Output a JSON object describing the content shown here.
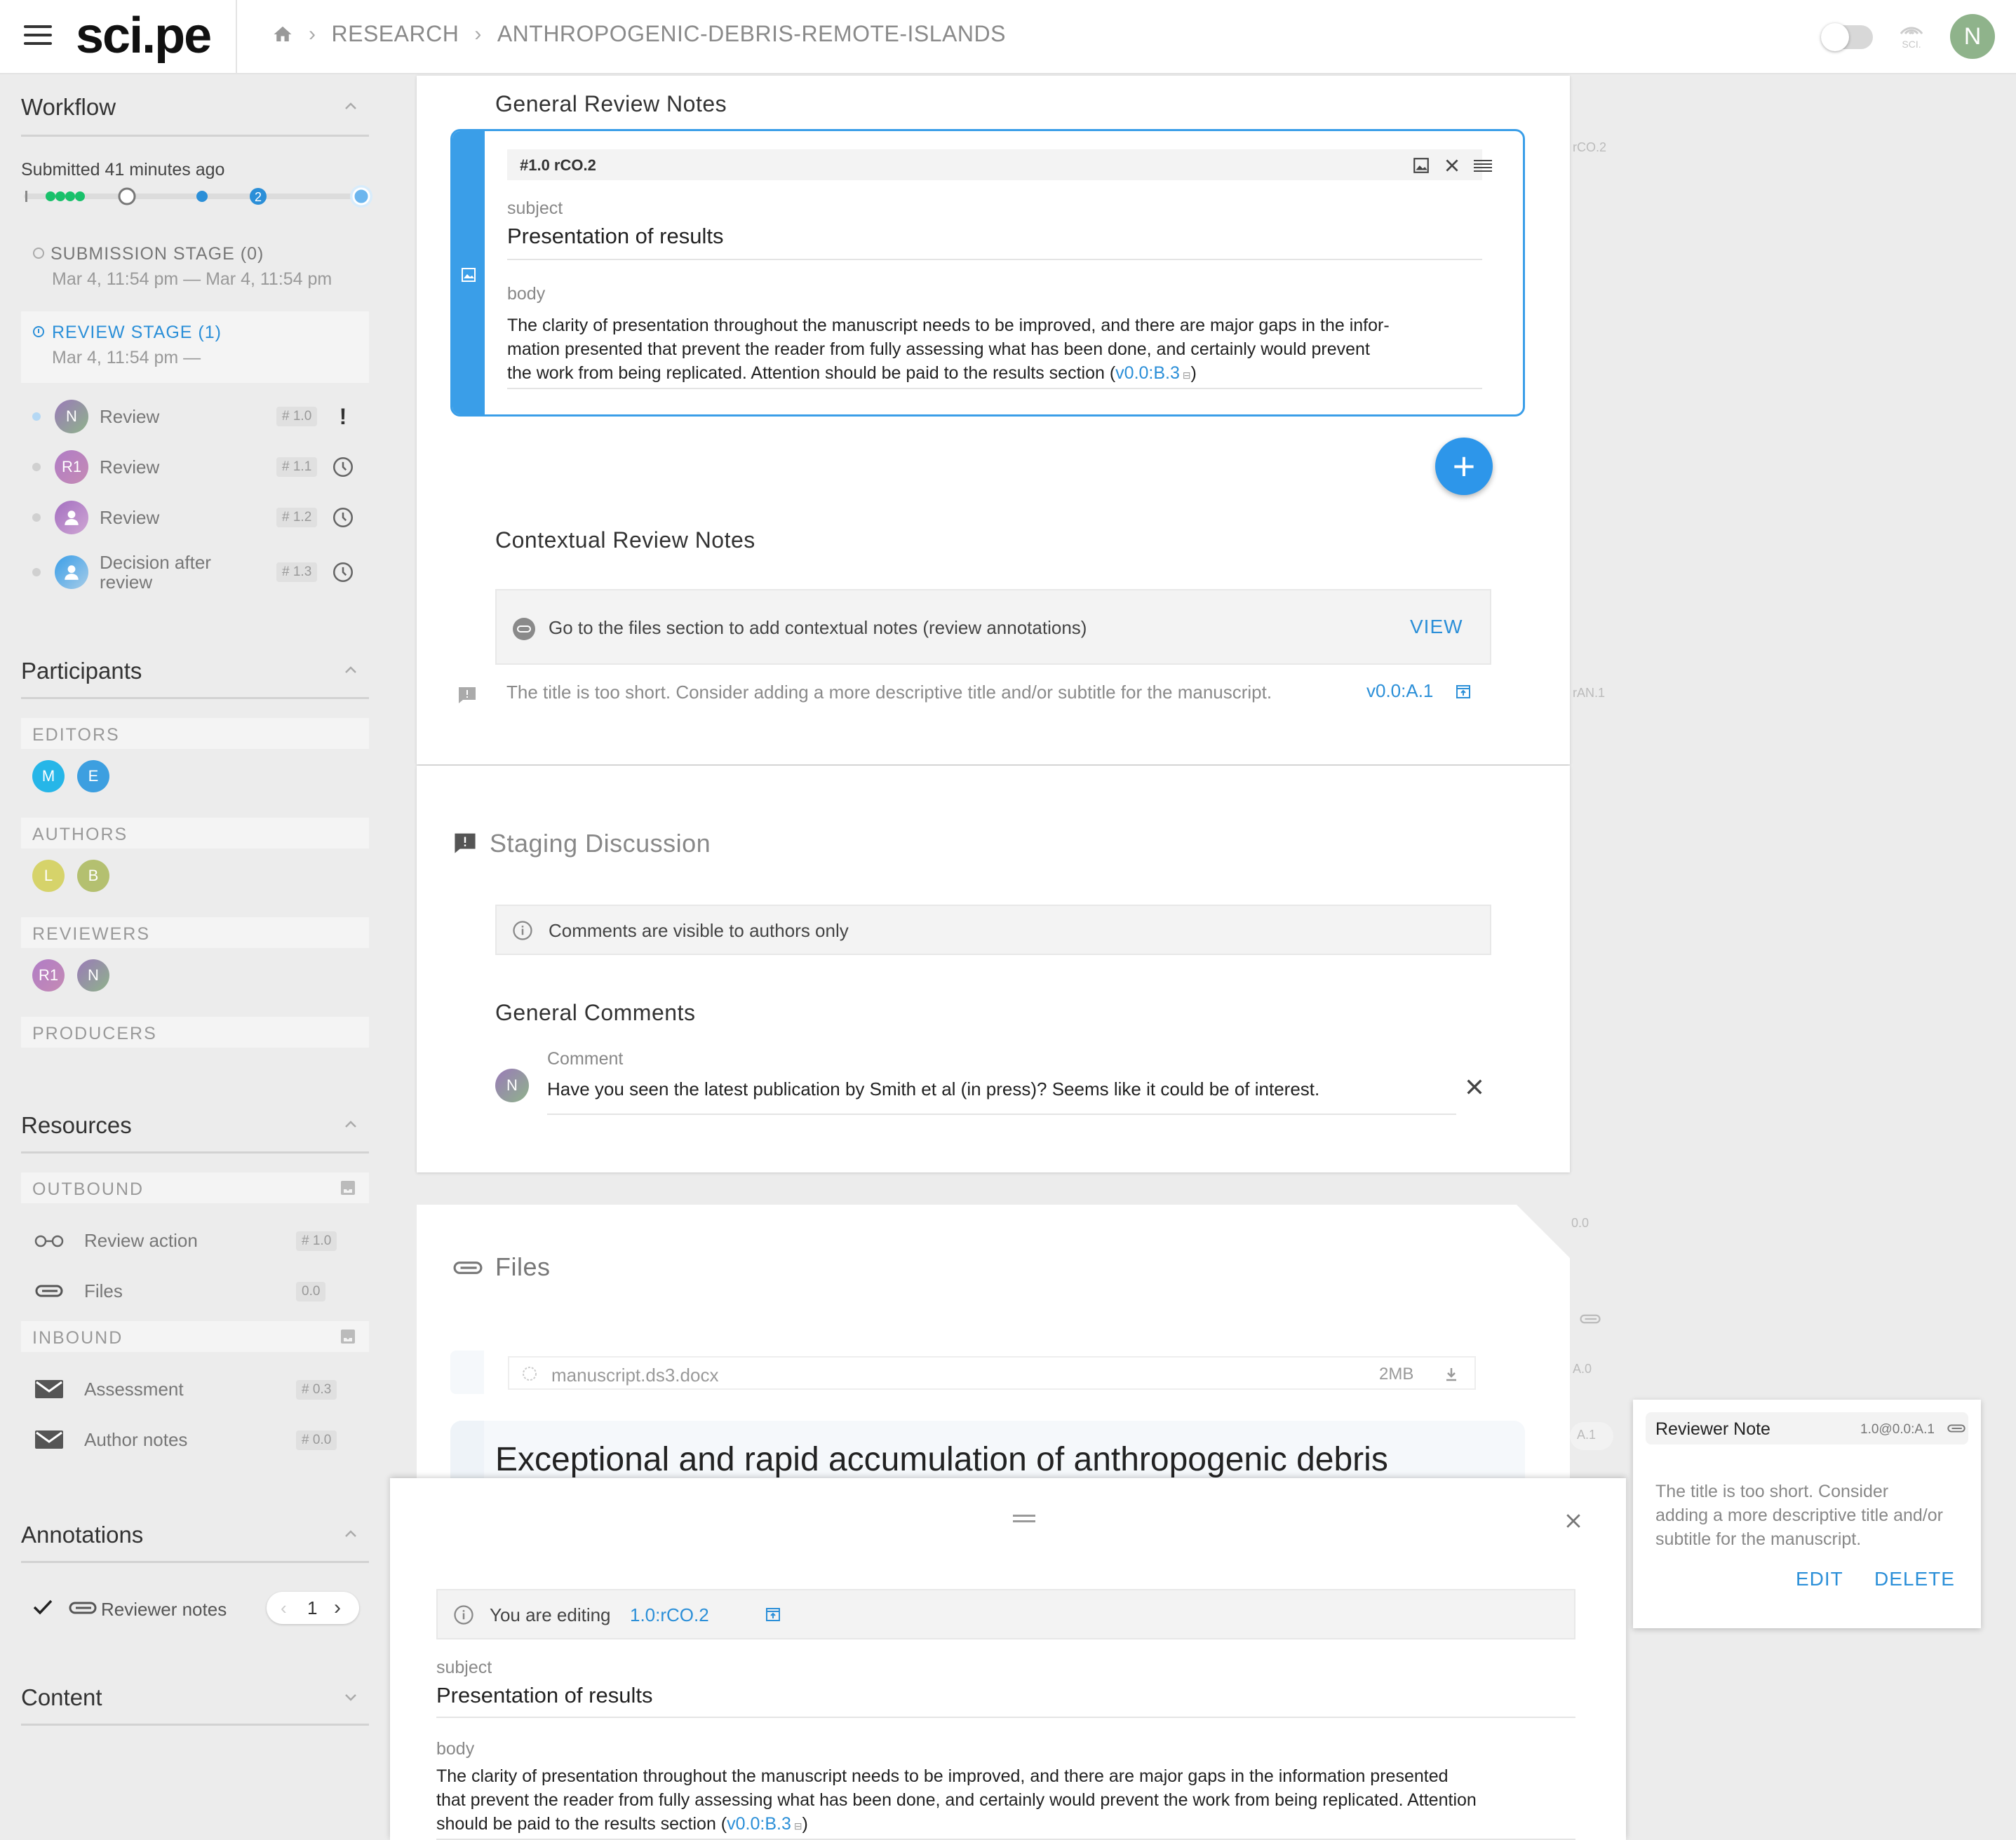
{
  "header": {
    "logo": "sci.pe",
    "breadcrumbs": [
      "RESEARCH",
      "ANTHROPOGENIC-DEBRIS-REMOTE-ISLANDS"
    ],
    "avatar_initial": "N",
    "sig_label": "SCI."
  },
  "sidebar": {
    "workflow": {
      "title": "Workflow",
      "submitted": "Submitted 41 minutes ago",
      "progress_step": "2",
      "submission_stage": {
        "label": "SUBMISSION STAGE (0)",
        "dates": "Mar 4, 11:54 pm — Mar 4, 11:54 pm"
      },
      "review_stage": {
        "label": "REVIEW STAGE (1)",
        "dates": "Mar 4, 11:54 pm —"
      },
      "actions": [
        {
          "initial": "N",
          "label": "Review",
          "tag": "# 1.0"
        },
        {
          "initial": "R1",
          "label": "Review",
          "tag": "# 1.1"
        },
        {
          "initial": "",
          "label": "Review",
          "tag": "# 1.2"
        },
        {
          "initial": "",
          "label": "Decision after review",
          "tag": "# 1.3"
        }
      ]
    },
    "participants": {
      "title": "Participants",
      "roles": [
        "EDITORS",
        "AUTHORS",
        "REVIEWERS",
        "PRODUCERS"
      ],
      "editors": [
        "M",
        "E"
      ],
      "authors": [
        "L",
        "B"
      ],
      "reviewers": [
        "R1",
        "N"
      ]
    },
    "resources": {
      "title": "Resources",
      "outbound_label": "OUTBOUND",
      "inbound_label": "INBOUND",
      "outbound": [
        {
          "label": "Review action",
          "tag": "# 1.0"
        },
        {
          "label": "Files",
          "tag": "0.0"
        }
      ],
      "inbound": [
        {
          "label": "Assessment",
          "tag": "# 0.3"
        },
        {
          "label": "Author notes",
          "tag": "# 0.0"
        }
      ]
    },
    "annotations": {
      "title": "Annotations",
      "item": "Reviewer notes",
      "count": "1"
    },
    "content": {
      "title": "Content"
    }
  },
  "main": {
    "general_review_notes": {
      "heading": "General Review Notes",
      "note_id": "#1.0 rCO.2",
      "subject_label": "subject",
      "subject": "Presentation of results",
      "body_label": "body",
      "body_line1": "The clarity of presentation throughout the manuscript needs to be improved, and there are major gaps in the infor-",
      "body_line2": "mation presented that prevent the reader from fully assessing what has been done, and certainly would prevent",
      "body_line3": "the work from being replicated. Attention should be paid to the results section (",
      "body_link": "v0.0:B.3",
      "body_end": ")",
      "side_tag": "rCO.2"
    },
    "contextual_review_notes": {
      "heading": "Contextual Review Notes",
      "info": "Go to the files section to add contextual notes (review annotations)",
      "view_button": "VIEW",
      "note": "The title is too short. Consider adding a more descriptive title and/or subtitle for the manuscript.",
      "note_link": "v0.0:A.1",
      "side_tag": "rAN.1"
    },
    "staging_discussion": {
      "heading": "Staging Discussion",
      "info": "Comments are visible to authors only",
      "general_comments": "General Comments",
      "comment_label": "Comment",
      "comment_avatar": "N",
      "comment": "Have you seen the latest publication by Smith et al (in press)? Seems like it could be of interest."
    },
    "files": {
      "heading": "Files",
      "filename": "manuscript.ds3.docx",
      "size": "2MB",
      "title": "Exceptional and rapid accumulation of anthropogenic debris",
      "side_tags": [
        "0.0",
        "A.0",
        "A.1"
      ]
    }
  },
  "editor_panel": {
    "editing_prefix": "You are editing",
    "editing_link": "1.0:rCO.2",
    "subject_label": "subject",
    "subject": "Presentation of results",
    "body_label": "body",
    "body_line1": "The clarity of presentation throughout the manuscript needs to be improved, and there are major gaps in the information presented",
    "body_line2": "that prevent the reader from fully assessing what has been done, and certainly would prevent the work from being replicated. Attention",
    "body_line3": "should be paid to the results section (",
    "body_link": "v0.0:B.3",
    "body_end": ")"
  },
  "reviewer_note_popover": {
    "title": "Reviewer Note",
    "ref": "1.0@0.0:A.1",
    "text_line1": "The title is too short. Consider",
    "text_line2": "adding a more descriptive title and/or",
    "text_line3": "subtitle for the manuscript.",
    "edit": "EDIT",
    "delete": "DELETE"
  },
  "colors": {
    "accent": "#2b8fd8",
    "green": "#19c16b",
    "brand_bg": "#ffffff"
  }
}
